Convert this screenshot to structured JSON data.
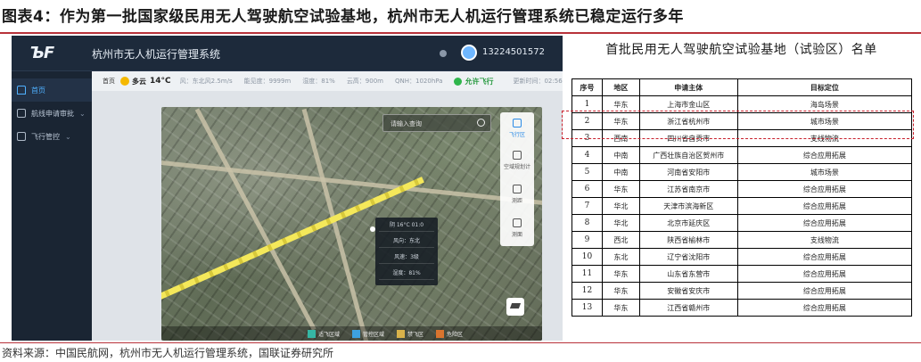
{
  "figure": {
    "title": "图表4：作为第一批国家级民用无人驾驶航空试验基地，杭州市无人机运行管理系统已稳定运行多年",
    "source": "资料来源：中国民航网，杭州市无人机运行管理系统，国联证券研究所"
  },
  "app": {
    "logo": "\u0005",
    "name": "杭州市无人机运行管理系统",
    "user_phone": "13224501572",
    "sidebar": [
      {
        "label": "首页",
        "icon": "home-icon"
      },
      {
        "label": "航线申请审批",
        "icon": "list-icon"
      },
      {
        "label": "飞行管控",
        "icon": "calendar-icon"
      }
    ],
    "infobar": {
      "home": "首页",
      "weather": "多云",
      "temperature": "14°C",
      "stats": [
        "风：东北风2.5m/s",
        "能见度：9999m",
        "湿度：81%",
        "云高：900m",
        "QNH：1020hPa"
      ],
      "status": "允许飞行",
      "update": "更新时间：02:56"
    },
    "map": {
      "search_placeholder": "请输入查询",
      "tools": [
        "飞行区",
        "空域规划计",
        "测距",
        "测面"
      ],
      "popup": {
        "header": "阴 16°C   01:0",
        "rows": [
          "风向：东北",
          "风速：3级",
          "湿度：81%"
        ]
      },
      "legend": [
        "适飞区域",
        "管控区域",
        "禁飞区",
        "危险区"
      ],
      "legend_colors": [
        "#35b6a4",
        "#3da1e0",
        "#d9b24a",
        "#d9742e"
      ]
    }
  },
  "table": {
    "title": "首批民用无人驾驶航空试验基地（试验区）名单",
    "headers": [
      "序号",
      "地区",
      "申请主体",
      "目标定位"
    ],
    "rows": [
      [
        "1",
        "华东",
        "上海市金山区",
        "海岛场景"
      ],
      [
        "2",
        "华东",
        "浙江省杭州市",
        "城市场景"
      ],
      [
        "3",
        "西南",
        "四川省自贡市",
        "支线物流"
      ],
      [
        "4",
        "中南",
        "广西壮族自治区贺州市",
        "综合应用拓展"
      ],
      [
        "5",
        "中南",
        "河南省安阳市",
        "城市场景"
      ],
      [
        "6",
        "华东",
        "江苏省南京市",
        "综合应用拓展"
      ],
      [
        "7",
        "华北",
        "天津市滨海新区",
        "综合应用拓展"
      ],
      [
        "8",
        "华北",
        "北京市延庆区",
        "综合应用拓展"
      ],
      [
        "9",
        "西北",
        "陕西省榆林市",
        "支线物流"
      ],
      [
        "10",
        "东北",
        "辽宁省沈阳市",
        "综合应用拓展"
      ],
      [
        "11",
        "华东",
        "山东省东营市",
        "综合应用拓展"
      ],
      [
        "12",
        "华东",
        "安徽省安庆市",
        "综合应用拓展"
      ],
      [
        "13",
        "华东",
        "江西省赣州市",
        "综合应用拓展"
      ]
    ]
  }
}
